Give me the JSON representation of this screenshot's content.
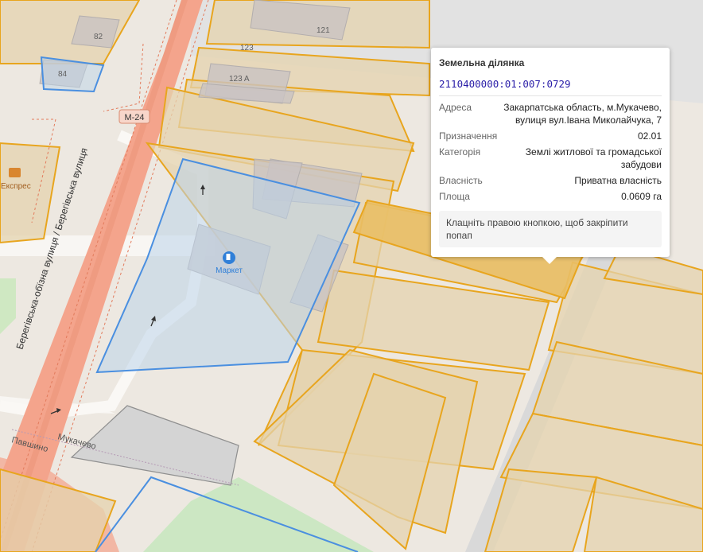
{
  "map": {
    "road_badge": "M-24",
    "street_name": "Берегівська-обїзна вулиця / Берегівська вулиця",
    "poi_label": "Експрес",
    "store_label": "Маркет",
    "buildings": [
      "82",
      "84",
      "121",
      "123",
      "123 A"
    ],
    "locality_1": "Мукачево",
    "locality_2": "Павшино"
  },
  "popup": {
    "title": "Земельна ділянка",
    "cadastral_number": "2110400000:01:007:0729",
    "rows": [
      {
        "key": "Адреса",
        "value": "Закарпатська область, м.Мукачево, вулиця вул.Івана Миколайчука, 7"
      },
      {
        "key": "Призначення",
        "value": "02.01"
      },
      {
        "key": "Категорія",
        "value": "Землі житлової та громадської забудови"
      },
      {
        "key": "Власність",
        "value": "Приватна власність"
      },
      {
        "key": "Площа",
        "value": "0.0609 га"
      }
    ],
    "hint": "Клацніть правою кнопкою, щоб закріпити попап"
  },
  "colors": {
    "parcel_outline": "#e8a51e",
    "parcel_fill": "#ead9b4",
    "selected_fill": "#e9bf66",
    "blue_outline": "#4a8fe0",
    "road": "#f4a48c"
  }
}
